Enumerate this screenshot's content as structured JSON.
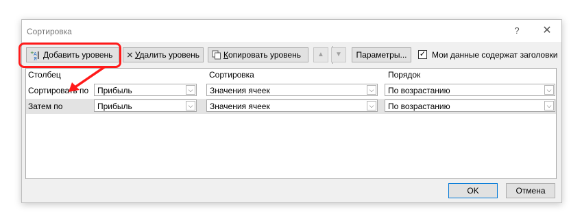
{
  "window": {
    "title": "Сортировка",
    "help": "?",
    "close": "✕"
  },
  "toolbar": {
    "add_prefix": "Д",
    "add_rest": "обавить уровень",
    "delete_prefix": "У",
    "delete_rest": "далить уровень",
    "copy_prefix": "К",
    "copy_rest": "опировать уровень",
    "move_up": "▲",
    "move_down": "▼",
    "options": "Параметры...",
    "headers_checkbox": {
      "checked": true,
      "mark": "✓",
      "label": "Мои данные содержат заголовки"
    }
  },
  "grid": {
    "headers": {
      "column": "Столбец",
      "sort_on": "Сортировка",
      "order": "Порядок"
    },
    "rows": [
      {
        "label": "Сортировать по",
        "column": "Прибыль",
        "sort_on": "Значения ячеек",
        "order": "По возрастанию"
      },
      {
        "label": "Затем по",
        "column": "Прибыль",
        "sort_on": "Значения ячеек",
        "order": "По возрастанию"
      }
    ]
  },
  "buttons": {
    "ok": "OK",
    "cancel": "Отмена"
  },
  "colors": {
    "highlight": "#ff1a1a",
    "dialog_bg": "#f0f0f0",
    "selected_row": "#e3e3e3"
  }
}
